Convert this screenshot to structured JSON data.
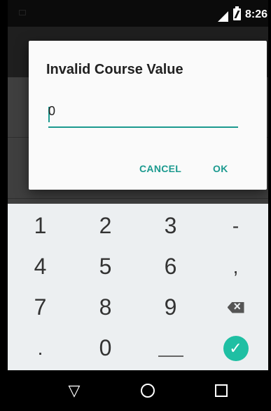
{
  "status_bar": {
    "time": "8:26"
  },
  "dialog": {
    "title": "Invalid Course Value",
    "input_value": "0",
    "cancel_label": "CANCEL",
    "ok_label": "OK"
  },
  "keyboard": {
    "keys": [
      "1",
      "2",
      "3",
      "-",
      "4",
      "5",
      "6",
      ",",
      "7",
      "8",
      "9",
      "delete",
      ".",
      "0",
      "space",
      "enter"
    ],
    "labels": {
      "k1": "1",
      "k2": "2",
      "k3": "3",
      "minus": "-",
      "k4": "4",
      "k5": "5",
      "k6": "6",
      "comma": ",",
      "k7": "7",
      "k8": "8",
      "k9": "9",
      "dot": ".",
      "k0": "0"
    },
    "enter_glyph": "✓"
  },
  "nav_bar": {
    "back_glyph": "▽",
    "home_icon": "home-circle-icon",
    "recents_icon": "recents-square-icon"
  },
  "colors": {
    "accent": "#1c9a8f",
    "enter_key": "#1fbfa3",
    "keyboard_bg": "#eceff1",
    "dialog_bg": "#fafafa"
  }
}
